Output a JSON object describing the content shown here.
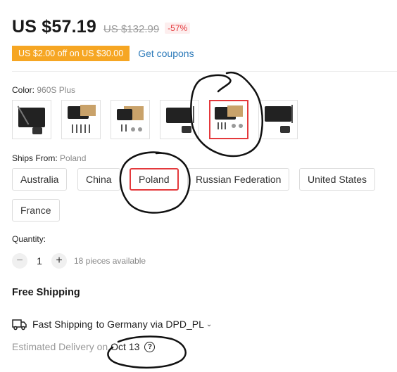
{
  "price": {
    "current": "US $57.19",
    "original": "US $132.99",
    "discount": "-57%"
  },
  "coupon": {
    "badge": "US $2.00 off on US $30.00",
    "link": "Get coupons"
  },
  "color": {
    "label": "Color: ",
    "value": "960S Plus",
    "selected_index": 4,
    "option_count": 6
  },
  "ships": {
    "label": "Ships From: ",
    "value": "Poland",
    "options": [
      "Australia",
      "China",
      "Poland",
      "Russian Federation",
      "United States",
      "France"
    ],
    "selected_index": 2
  },
  "quantity": {
    "label": "Quantity:",
    "minus": "−",
    "value": "1",
    "plus": "+",
    "available": "18 pieces available"
  },
  "shipping": {
    "free": "Free Shipping",
    "method": "Fast Shipping",
    "destination": "to Germany via DPD_PL",
    "chevron": "⌄",
    "estimate_label": "Estimated Delivery on",
    "estimate_date": "Oct 13",
    "help": "?"
  },
  "icons": {
    "truck": "truck-icon",
    "help": "help-circle-icon",
    "chevron": "chevron-down-icon"
  },
  "colors": {
    "accent": "#e4393c",
    "coupon": "#f6a623",
    "link": "#2e7bba"
  }
}
